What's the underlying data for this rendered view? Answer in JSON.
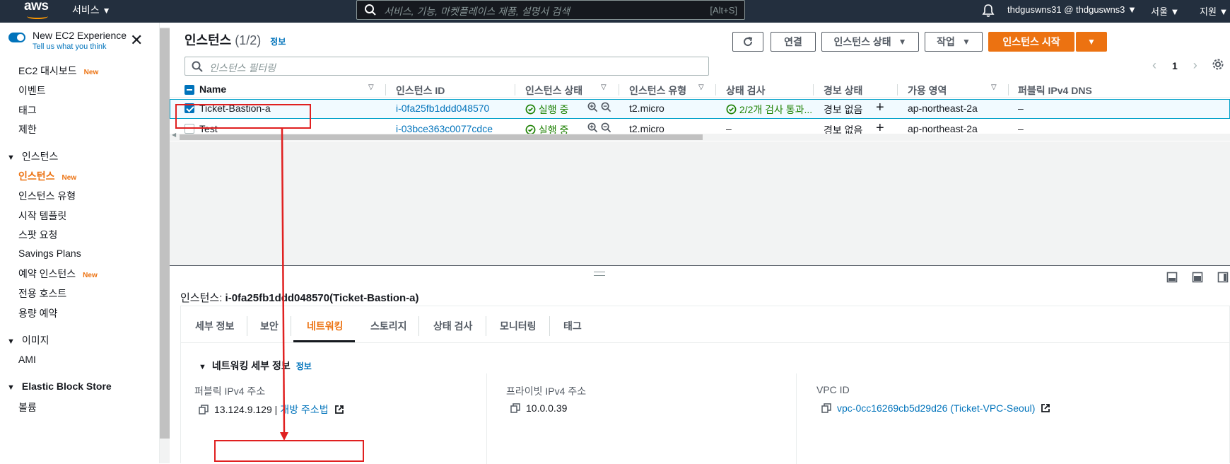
{
  "topnav": {
    "logo": "aws",
    "services": "서비스",
    "search_placeholder": "서비스, 기능, 마켓플레이스 제품, 설명서 검색",
    "search_shortcut": "[Alt+S]",
    "account": "thdguswns31 @ thdguswns3",
    "region": "서울",
    "support": "지원"
  },
  "sidebar": {
    "new_experience": "New EC2 Experience",
    "tell_us": "Tell us what you think",
    "items": [
      {
        "label": "EC2 대시보드",
        "badge": "New"
      },
      {
        "label": "이벤트"
      },
      {
        "label": "태그"
      },
      {
        "label": "제한"
      }
    ],
    "sections": [
      {
        "title": "인스턴스",
        "items": [
          {
            "label": "인스턴스",
            "badge": "New",
            "active": true
          },
          {
            "label": "인스턴스 유형"
          },
          {
            "label": "시작 템플릿"
          },
          {
            "label": "스팟 요청"
          },
          {
            "label": "Savings Plans"
          },
          {
            "label": "예약 인스턴스",
            "badge": "New"
          },
          {
            "label": "전용 호스트"
          },
          {
            "label": "용량 예약"
          }
        ]
      },
      {
        "title": "이미지",
        "items": [
          {
            "label": "AMI"
          }
        ]
      },
      {
        "title": "Elastic Block Store",
        "items": [
          {
            "label": "볼륨"
          }
        ]
      }
    ]
  },
  "header": {
    "title": "인스턴스",
    "count": "(1/2)",
    "info": "정보",
    "connect": "연결",
    "instance_state": "인스턴스 상태",
    "actions": "작업",
    "launch": "인스턴스 시작",
    "filter_placeholder": "인스턴스 필터링",
    "page": "1"
  },
  "table": {
    "columns": [
      "Name",
      "인스턴스 ID",
      "인스턴스 상태",
      "인스턴스 유형",
      "상태 검사",
      "경보 상태",
      "가용 영역",
      "퍼블릭 IPv4 DNS"
    ],
    "rows": [
      {
        "name": "Ticket-Bastion-a",
        "id": "i-0fa25fb1ddd048570",
        "state": "실행 중",
        "type": "t2.micro",
        "check": "2/2개 검사 통과...",
        "alarm": "경보 없음",
        "az": "ap-northeast-2a",
        "dns": "–",
        "selected": true
      },
      {
        "name": "Test",
        "id": "i-03bce363c0077cdce",
        "state": "실행 중",
        "type": "t2.micro",
        "check": "–",
        "alarm": "경보 없음",
        "az": "ap-northeast-2a",
        "dns": "–",
        "selected": false
      }
    ]
  },
  "detail": {
    "prefix": "인스턴스:",
    "instance": "i-0fa25fb1ddd048570(Ticket-Bastion-a)",
    "tabs": [
      "세부 정보",
      "보안",
      "네트워킹",
      "스토리지",
      "상태 검사",
      "모니터링",
      "태그"
    ],
    "active_tab": "네트워킹",
    "section_title": "네트워킹 세부 정보",
    "section_info": "정보",
    "public_ipv4_label": "퍼블릭 IPv4 주소",
    "public_ipv4": "13.124.9.129 |",
    "open_address": "개방 주소법",
    "private_ipv4_label": "프라이빗 IPv4 주소",
    "private_ipv4": "10.0.0.39",
    "vpc_label": "VPC ID",
    "vpc": "vpc-0cc16269cb5d29d26 (Ticket-VPC-Seoul)"
  },
  "colors": {
    "accent": "#ec7211",
    "link": "#0073bb",
    "ok": "#1d8102",
    "nav_bg": "#232f3e",
    "annotation": "#e02020"
  }
}
